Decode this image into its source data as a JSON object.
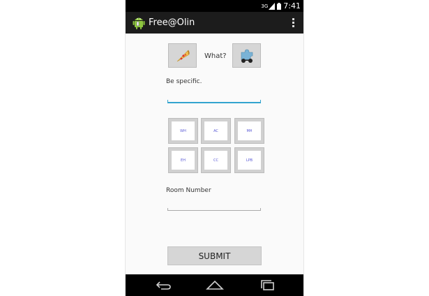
{
  "status_bar": {
    "network": "3G",
    "time": "7:41"
  },
  "action_bar": {
    "title": "Free@Olin",
    "overflow_icon": "overflow-menu-icon"
  },
  "form": {
    "food_left_icon": "pizza-icon",
    "food_prompt": "What?",
    "food_right_icon": "puzzle-icon",
    "description_label": "Be specific.",
    "description_value": "",
    "buildings": [
      "WH",
      "AC",
      "MH",
      "EH",
      "CC",
      "LPB"
    ],
    "room_label": "Room Number",
    "room_value": "",
    "submit_label": "SUBMIT"
  },
  "nav": {
    "back_icon": "back-icon",
    "home_icon": "home-icon",
    "recents_icon": "recents-icon"
  },
  "colors": {
    "accent": "#33a4cf",
    "action_bar": "#1c1c1c",
    "button": "#d6d6d6",
    "building_text": "#5a5ad6"
  }
}
